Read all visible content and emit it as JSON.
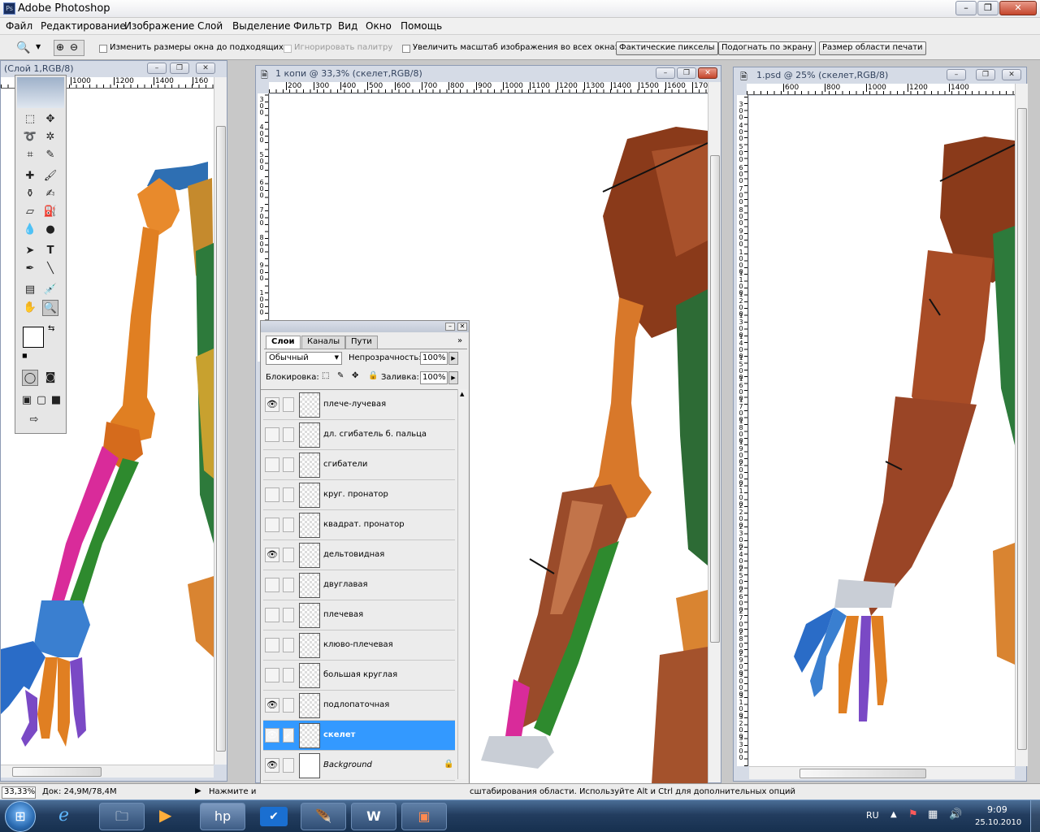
{
  "app": {
    "title": "Adobe Photoshop"
  },
  "menu": [
    "Файл",
    "Редактирование",
    "Изображение",
    "Слой",
    "Выделение",
    "Фильтр",
    "Вид",
    "Окно",
    "Помощь"
  ],
  "options": {
    "resize_windows": "Изменить размеры окна до подходящих",
    "ignore_palettes": "Игнорировать палитру",
    "zoom_all_windows": "Увеличить масштаб изображения во всех окнах",
    "actual_pixels": "Фактические пикселы",
    "fit_screen": "Подогнать по экрану",
    "print_size": "Размер области печати"
  },
  "windows": {
    "left": {
      "title": "(Слой 1,RGB/8)",
      "ruler": [
        "1000",
        "1200",
        "1400",
        "160"
      ]
    },
    "middle": {
      "title": "1 копи @ 33,3% (скелет,RGB/8)",
      "ruler": [
        "200",
        "300",
        "400",
        "500",
        "600",
        "700",
        "800",
        "900",
        "1000",
        "1100",
        "1200",
        "1300",
        "1400",
        "1500",
        "1600",
        "170"
      ],
      "vruler": [
        "300",
        "400",
        "500",
        "600",
        "700",
        "800",
        "900",
        "1000"
      ]
    },
    "right": {
      "title": "1.psd @ 25% (скелет,RGB/8)",
      "ruler": [
        "600",
        "800",
        "1000",
        "1200",
        "1400"
      ],
      "vruler": [
        "300",
        "400",
        "500",
        "600",
        "700",
        "800",
        "900",
        "1000",
        "1100",
        "1200",
        "1300",
        "1400",
        "1500",
        "1600",
        "1700",
        "1800",
        "1900",
        "2000",
        "2100",
        "2200",
        "2300",
        "2400",
        "2500",
        "2600",
        "2700",
        "2800",
        "2900",
        "3000",
        "3100",
        "3200",
        "3300"
      ]
    }
  },
  "layers_panel": {
    "tabs": [
      "Слои",
      "Каналы",
      "Пути"
    ],
    "blend_mode": "Обычный",
    "opacity_label": "Непрозрачность:",
    "opacity_value": "100%",
    "lock_label": "Блокировка:",
    "fill_label": "Заливка:",
    "fill_value": "100%",
    "layers": [
      {
        "name": "плече-лучевая",
        "visible": true
      },
      {
        "name": "дл. сгибатель б. пальца",
        "visible": false
      },
      {
        "name": "сгибатели",
        "visible": false
      },
      {
        "name": "круг. пронатор",
        "visible": false
      },
      {
        "name": "квадрат. пронатор",
        "visible": false
      },
      {
        "name": "дельтовидная",
        "visible": true
      },
      {
        "name": "двуглавая",
        "visible": false
      },
      {
        "name": "плечевая",
        "visible": false
      },
      {
        "name": "клюво-плечевая",
        "visible": false
      },
      {
        "name": "большая круглая",
        "visible": false
      },
      {
        "name": "подлопаточная",
        "visible": true
      },
      {
        "name": "скелет",
        "visible": true,
        "selected": true
      },
      {
        "name": "Background",
        "visible": true,
        "locked": true
      }
    ]
  },
  "status": {
    "zoom": "33,33%",
    "doc": "Док: 24,9M/78,4M",
    "hint_a": "Нажмите и",
    "hint_b": "сштабирования области. Используйте Alt и Ctrl для дополнительных опций"
  },
  "taskbar": {
    "lang": "RU",
    "time": "9:09",
    "date": "25.10.2010"
  }
}
